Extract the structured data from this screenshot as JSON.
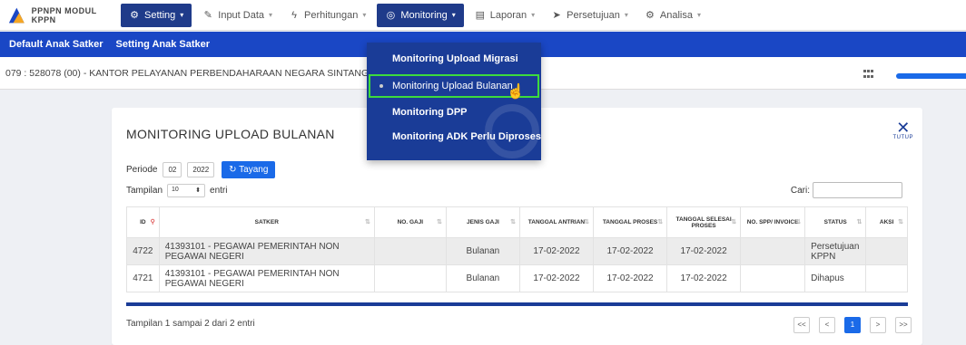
{
  "app": {
    "brand": "PPNPN MODUL KPPN"
  },
  "nav": [
    {
      "label": "Setting",
      "icon": "gear-icon",
      "dark": true
    },
    {
      "label": "Input Data",
      "icon": "edit-icon",
      "dark": false
    },
    {
      "label": "Perhitungan",
      "icon": "lightning-icon",
      "dark": false
    },
    {
      "label": "Monitoring",
      "icon": "target-icon",
      "dark": true
    },
    {
      "label": "Laporan",
      "icon": "document-icon",
      "dark": false
    },
    {
      "label": "Persetujuan",
      "icon": "send-icon",
      "dark": false
    },
    {
      "label": "Analisa",
      "icon": "gear-icon",
      "dark": false
    }
  ],
  "subnav": {
    "item1": "Default Anak Satker",
    "item2": "Setting Anak Satker"
  },
  "breadcrumb": "079 : 528078 (00) - KANTOR PELAYANAN PERBENDAHARAAN NEGARA SINTANG (KPPN SINTANG)",
  "dropdown": {
    "item1": "Monitoring Upload Migrasi",
    "item2": "Monitoring Upload Bulanan",
    "item3": "Monitoring DPP",
    "item4": "Monitoring ADK Perlu Diproses"
  },
  "card": {
    "title": "MONITORING UPLOAD BULANAN",
    "close_label": "TUTUP",
    "periode_label": "Periode",
    "month": "02",
    "year": "2022",
    "tayang_label": "Tayang",
    "tampilan_label": "Tampilan",
    "tampilan_value": "10",
    "entri_label": "entri",
    "cari_label": "Cari:",
    "footer_info": "Tampilan 1 sampai 2 dari 2 entri"
  },
  "table": {
    "headers": [
      "ID",
      "SATKER",
      "NO. GAJI",
      "JENIS GAJI",
      "TANGGAL ANTRIAN",
      "TANGGAL PROSES",
      "TANGGAL SELESAI PROSES",
      "NO. SPP/ INVOICE",
      "STATUS",
      "AKSI"
    ],
    "rows": [
      {
        "id": "4722",
        "satker": "41393101 - PEGAWAI PEMERINTAH NON PEGAWAI NEGERI",
        "no_gaji": "",
        "jenis": "Bulanan",
        "antrian": "17-02-2022",
        "proses": "17-02-2022",
        "selesai": "17-02-2022",
        "spp": "",
        "status": "Persetujuan KPPN",
        "aksi": ""
      },
      {
        "id": "4721",
        "satker": "41393101 - PEGAWAI PEMERINTAH NON PEGAWAI NEGERI",
        "no_gaji": "",
        "jenis": "Bulanan",
        "antrian": "17-02-2022",
        "proses": "17-02-2022",
        "selesai": "17-02-2022",
        "spp": "",
        "status": "Dihapus",
        "aksi": ""
      }
    ]
  },
  "pager": {
    "first": "<<",
    "prev": "<",
    "current": "1",
    "next": ">",
    "last": ">>"
  }
}
